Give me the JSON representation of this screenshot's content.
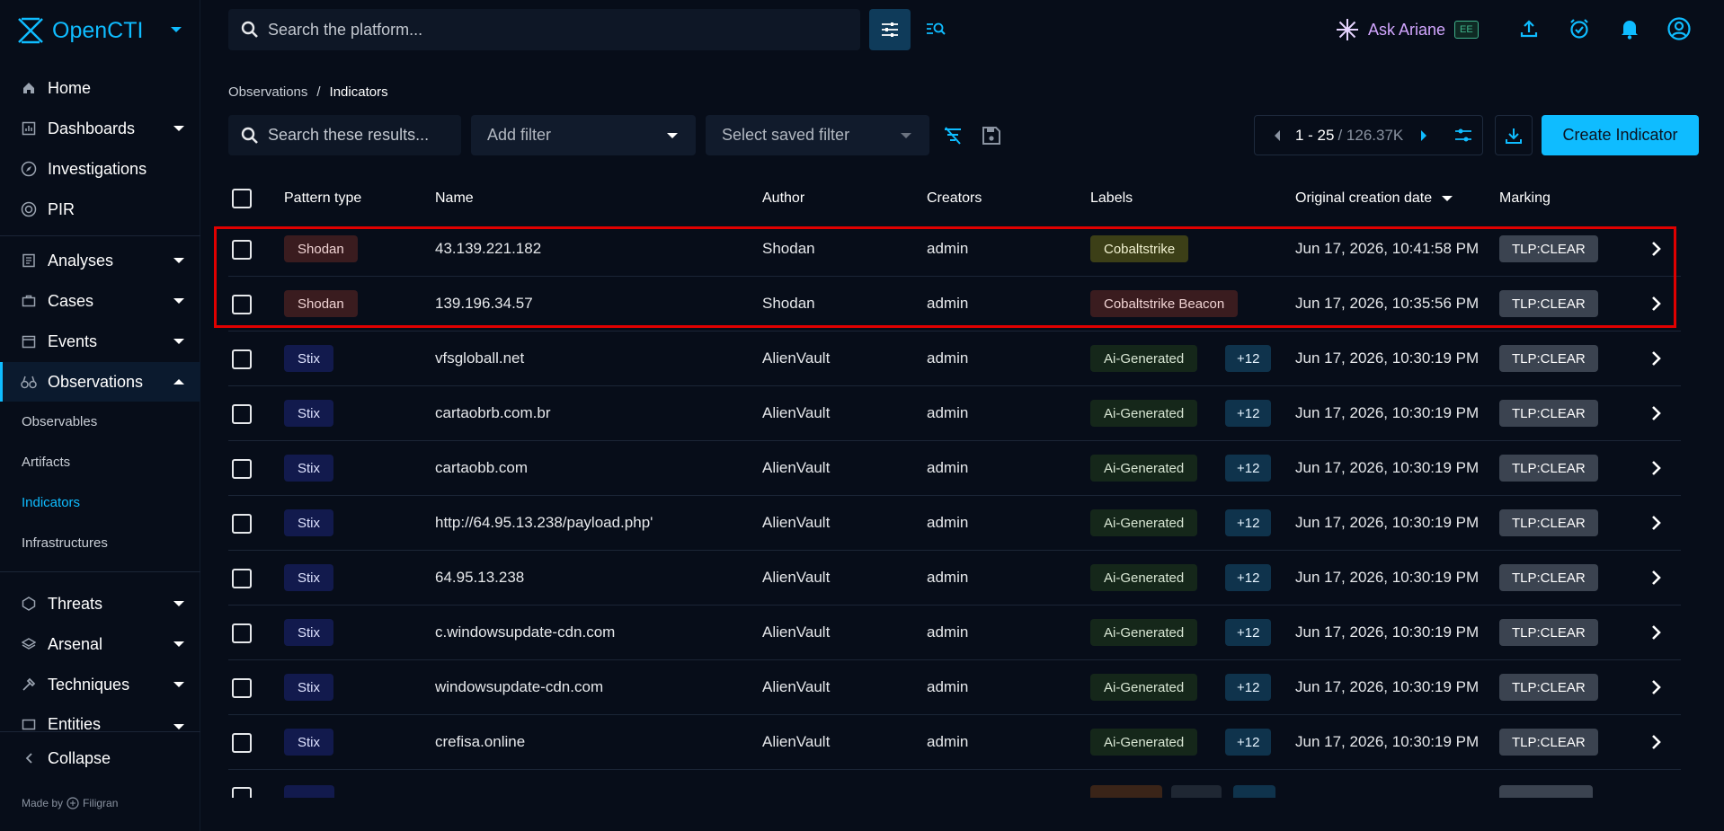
{
  "app": {
    "name": "OpenCTI"
  },
  "top": {
    "search_placeholder": "Search the platform...",
    "ask_ariane": "Ask Ariane",
    "ee_badge": "EE"
  },
  "sidebar": {
    "items": {
      "home": "Home",
      "dashboards": "Dashboards",
      "investigations": "Investigations",
      "pir": "PIR",
      "analyses": "Analyses",
      "cases": "Cases",
      "events": "Events",
      "observations": "Observations",
      "threats": "Threats",
      "arsenal": "Arsenal",
      "techniques": "Techniques",
      "entities": "Entities",
      "collapse": "Collapse"
    },
    "sub_items": {
      "observables": "Observables",
      "artifacts": "Artifacts",
      "indicators": "Indicators",
      "infrastructures": "Infrastructures"
    },
    "made_by": "Made by",
    "made_by_brand": "Filigran"
  },
  "breadcrumb": {
    "parent": "Observations",
    "separator": "/",
    "current": "Indicators"
  },
  "toolbar": {
    "search_placeholder": "Search these results...",
    "add_filter": "Add filter",
    "saved_filter": "Select saved filter",
    "pager_range": "1 - 25",
    "pager_total": "/ 126.37K",
    "create_label": "Create Indicator"
  },
  "table": {
    "headers": {
      "pattern_type": "Pattern type",
      "name": "Name",
      "author": "Author",
      "creators": "Creators",
      "labels": "Labels",
      "created": "Original creation date",
      "marking": "Marking"
    },
    "rows": [
      {
        "pattern": "Shodan",
        "name": "43.139.221.182",
        "author": "Shodan",
        "creator": "admin",
        "label": "Cobaltstrike",
        "extra": "",
        "date": "Jun 17, 2026, 10:41:58 PM",
        "marking": "TLP:CLEAR"
      },
      {
        "pattern": "Shodan",
        "name": "139.196.34.57",
        "author": "Shodan",
        "creator": "admin",
        "label": "Cobaltstrike Beacon",
        "extra": "",
        "date": "Jun 17, 2026, 10:35:56 PM",
        "marking": "TLP:CLEAR"
      },
      {
        "pattern": "Stix",
        "name": "vfsgloball.net",
        "author": "AlienVault",
        "creator": "admin",
        "label": "Ai-Generated",
        "extra": "+12",
        "date": "Jun 17, 2026, 10:30:19 PM",
        "marking": "TLP:CLEAR"
      },
      {
        "pattern": "Stix",
        "name": "cartaobrb.com.br",
        "author": "AlienVault",
        "creator": "admin",
        "label": "Ai-Generated",
        "extra": "+12",
        "date": "Jun 17, 2026, 10:30:19 PM",
        "marking": "TLP:CLEAR"
      },
      {
        "pattern": "Stix",
        "name": "cartaobb.com",
        "author": "AlienVault",
        "creator": "admin",
        "label": "Ai-Generated",
        "extra": "+12",
        "date": "Jun 17, 2026, 10:30:19 PM",
        "marking": "TLP:CLEAR"
      },
      {
        "pattern": "Stix",
        "name": "http://64.95.13.238/payload.php'",
        "author": "AlienVault",
        "creator": "admin",
        "label": "Ai-Generated",
        "extra": "+12",
        "date": "Jun 17, 2026, 10:30:19 PM",
        "marking": "TLP:CLEAR"
      },
      {
        "pattern": "Stix",
        "name": "64.95.13.238",
        "author": "AlienVault",
        "creator": "admin",
        "label": "Ai-Generated",
        "extra": "+12",
        "date": "Jun 17, 2026, 10:30:19 PM",
        "marking": "TLP:CLEAR"
      },
      {
        "pattern": "Stix",
        "name": "c.windowsupdate-cdn.com",
        "author": "AlienVault",
        "creator": "admin",
        "label": "Ai-Generated",
        "extra": "+12",
        "date": "Jun 17, 2026, 10:30:19 PM",
        "marking": "TLP:CLEAR"
      },
      {
        "pattern": "Stix",
        "name": "windowsupdate-cdn.com",
        "author": "AlienVault",
        "creator": "admin",
        "label": "Ai-Generated",
        "extra": "+12",
        "date": "Jun 17, 2026, 10:30:19 PM",
        "marking": "TLP:CLEAR"
      },
      {
        "pattern": "Stix",
        "name": "crefisa.online",
        "author": "AlienVault",
        "creator": "admin",
        "label": "Ai-Generated",
        "extra": "+12",
        "date": "Jun 17, 2026, 10:30:19 PM",
        "marking": "TLP:CLEAR"
      }
    ]
  },
  "colors": {
    "accent": "#0fbcff",
    "highlight": "#e00000",
    "background": "#070d19"
  }
}
